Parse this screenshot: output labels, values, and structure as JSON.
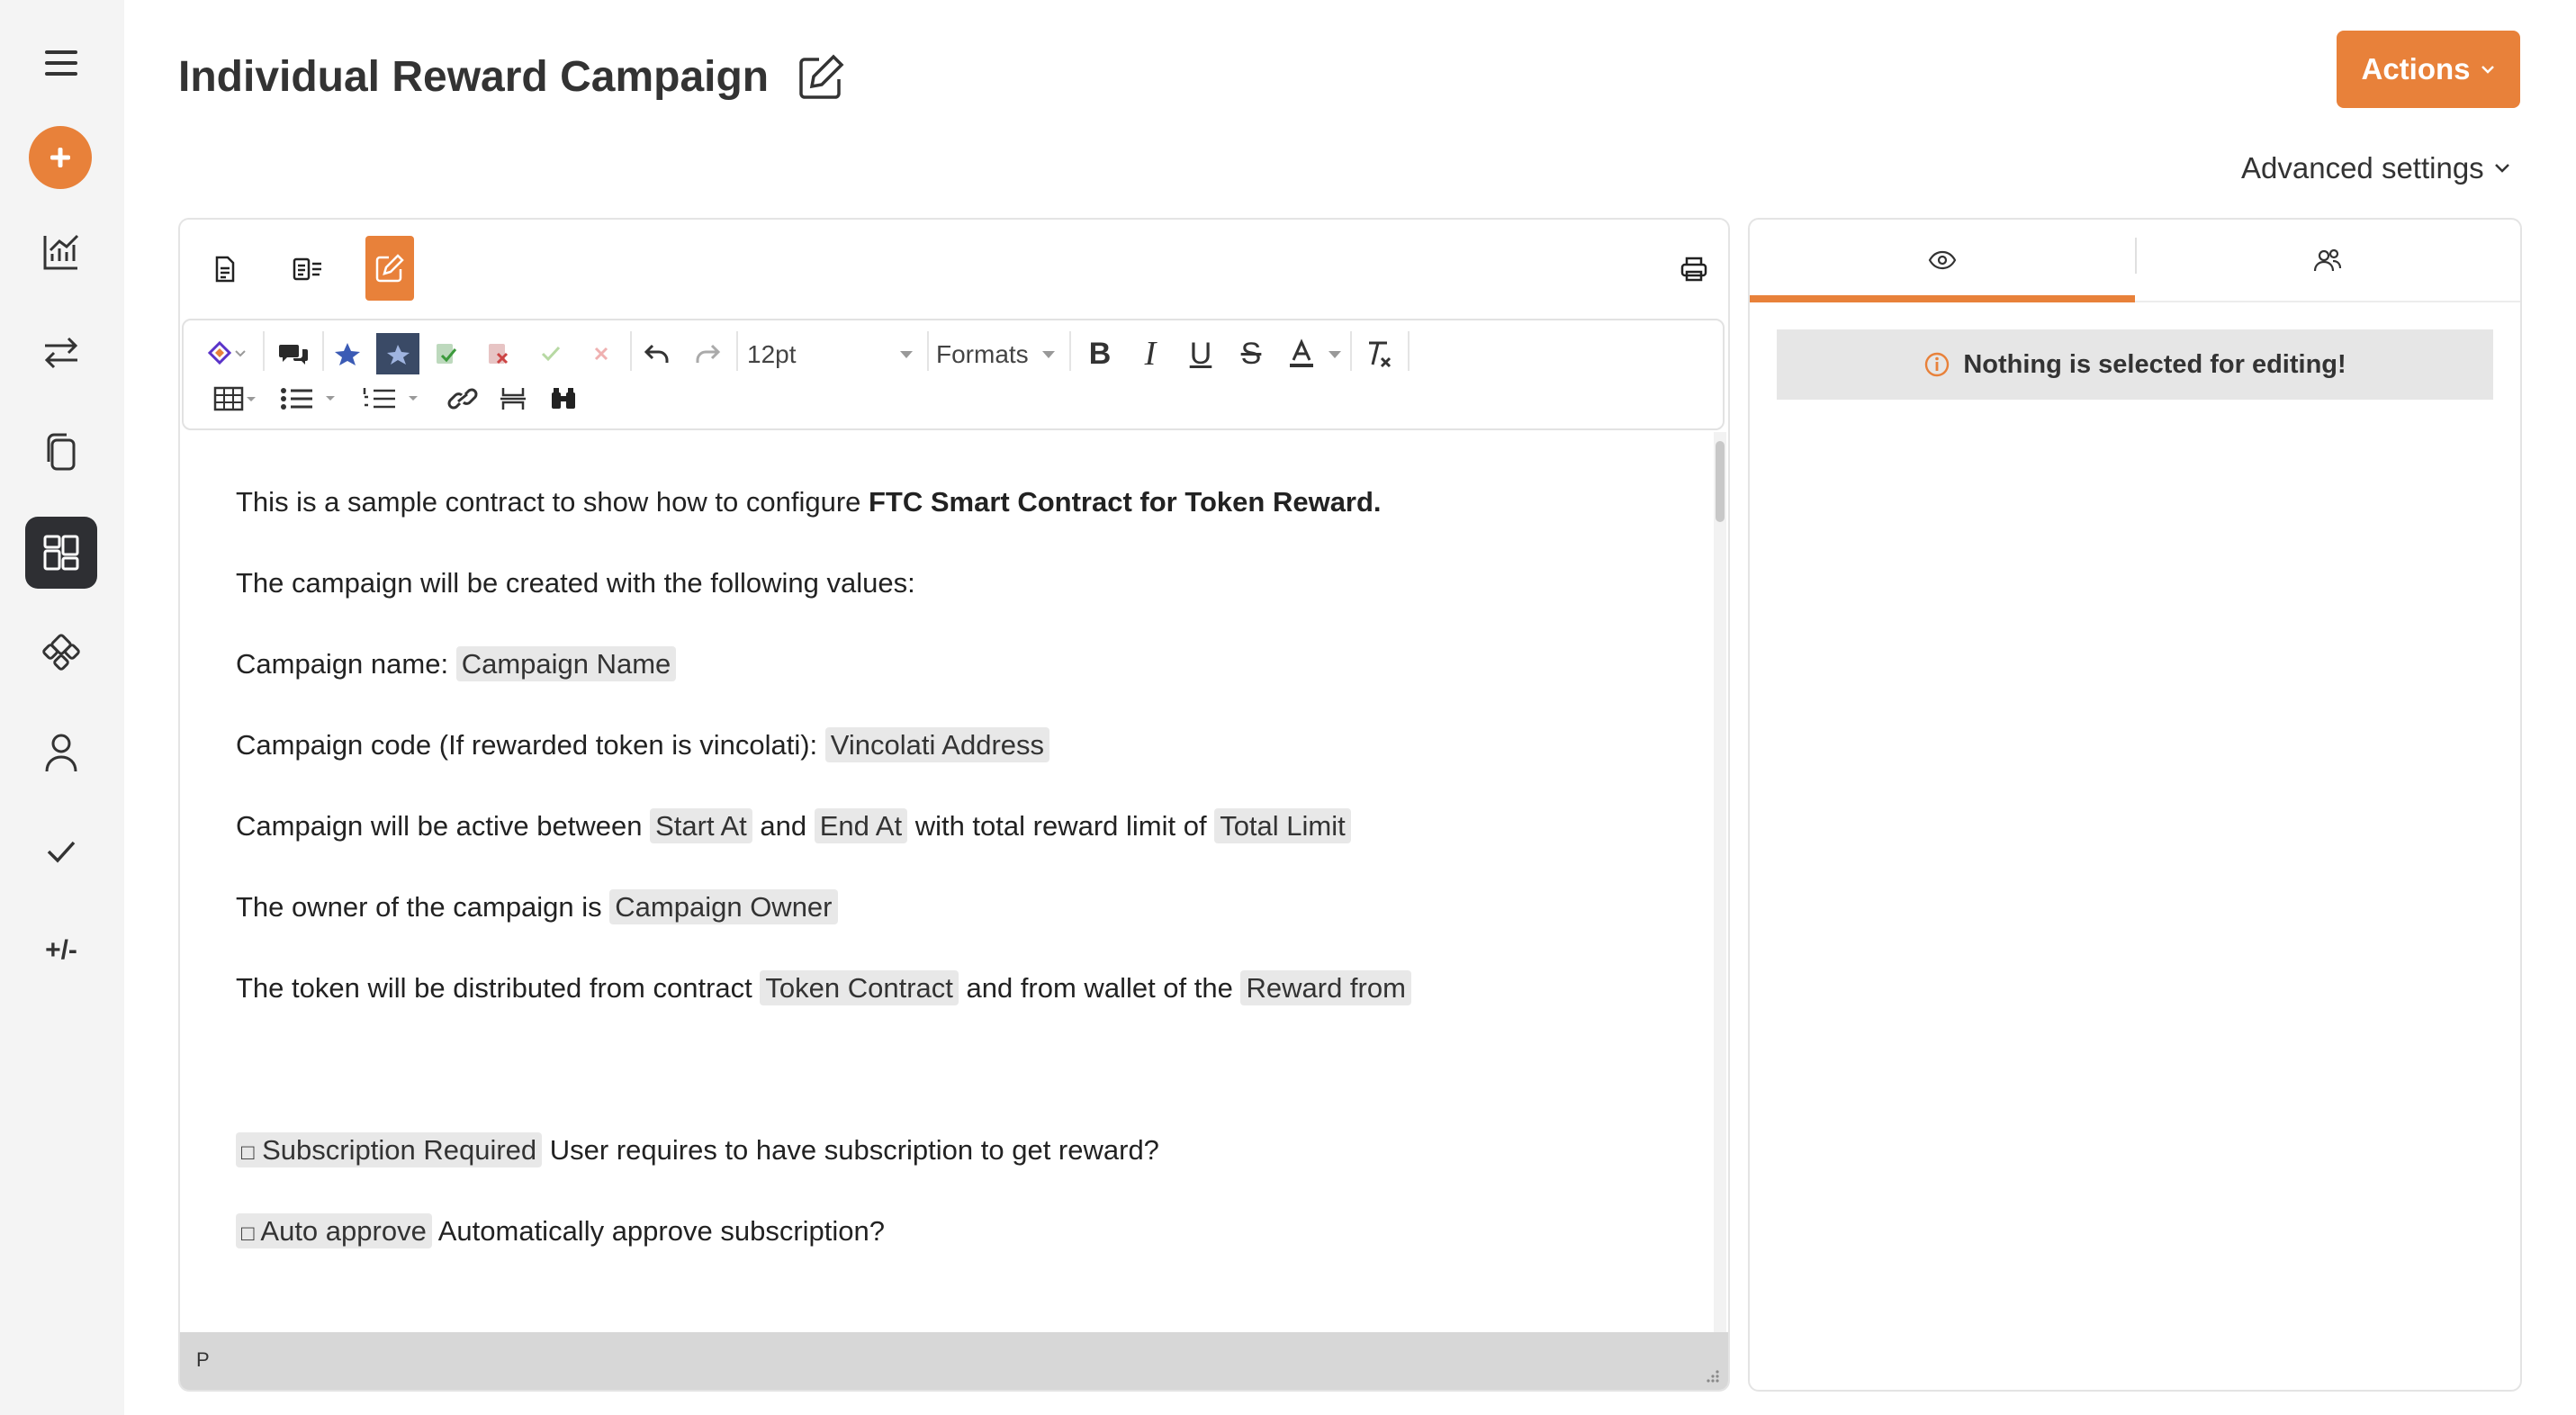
{
  "header": {
    "title": "Individual Reward Campaign",
    "actions_label": "Actions",
    "advanced_settings_label": "Advanced settings"
  },
  "sidebar": {
    "items": [
      {
        "icon": "menu-icon"
      },
      {
        "icon": "add-icon"
      },
      {
        "icon": "chart-icon"
      },
      {
        "icon": "transfer-icon"
      },
      {
        "icon": "documents-icon"
      },
      {
        "icon": "dashboard-icon",
        "active": true
      },
      {
        "icon": "modules-icon"
      },
      {
        "icon": "user-icon"
      },
      {
        "icon": "check-icon"
      },
      {
        "icon": "plus-minus-icon",
        "label": "+/-"
      }
    ]
  },
  "toolbar": {
    "font_size": "12pt",
    "formats_label": "Formats"
  },
  "content": {
    "p1_prefix": "This is a sample contract to show how to configure ",
    "p1_bold": "FTC Smart Contract for Token Reward.",
    "p2": "The campaign will be created with the following values:",
    "p3_prefix": "Campaign name: ",
    "p3_field": "Campaign Name",
    "p4_prefix": "Campaign code (If rewarded token is vincolati): ",
    "p4_field": "Vincolati Address",
    "p5_prefix": "Campaign will be active between ",
    "p5_field1": "Start At",
    "p5_mid1": " and ",
    "p5_field2": "End At",
    "p5_mid2": " with total reward limit of ",
    "p5_field3": "Total Limit",
    "p6_prefix": "The owner of the campaign is ",
    "p6_field": "Campaign Owner",
    "p7_prefix": "The token will be distributed from contract ",
    "p7_field1": "Token Contract",
    "p7_mid": " and from wallet of the ",
    "p7_field2": "Reward from",
    "cb1_mark": "□",
    "cb1_field": "Subscription Required",
    "cb1_text": " User requires to have subscription to get reward?",
    "cb2_mark": "□",
    "cb2_field": "Auto approve",
    "cb2_text": " Automatically approve subscription?"
  },
  "status_bar": {
    "element_path": "P"
  },
  "right_panel": {
    "tabs": [
      {
        "icon": "eye-icon",
        "active": true
      },
      {
        "icon": "users-icon",
        "active": false
      }
    ],
    "notice": "Nothing is selected for editing!"
  },
  "colors": {
    "accent": "#e8813a",
    "sidebar_bg": "#f4f4f4",
    "active_dark": "#2e2f33"
  }
}
